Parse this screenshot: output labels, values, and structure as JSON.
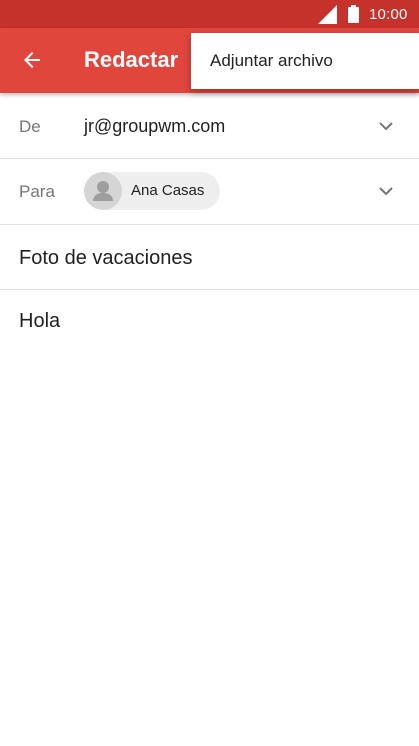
{
  "status_bar": {
    "time": "10:00",
    "background": "#c4322b",
    "icons": [
      "signal-icon",
      "battery-icon"
    ]
  },
  "app_bar": {
    "title": "Redactar",
    "background": "#e1463d",
    "back_icon": "arrow-back-icon"
  },
  "overflow_menu": {
    "items": [
      {
        "label": "Adjuntar archivo"
      }
    ]
  },
  "compose": {
    "from": {
      "label": "De",
      "value": "jr@groupwm.com"
    },
    "to": {
      "label": "Para",
      "recipient": "Ana Casas"
    },
    "subject": "Foto de vacaciones",
    "body": "Hola"
  }
}
